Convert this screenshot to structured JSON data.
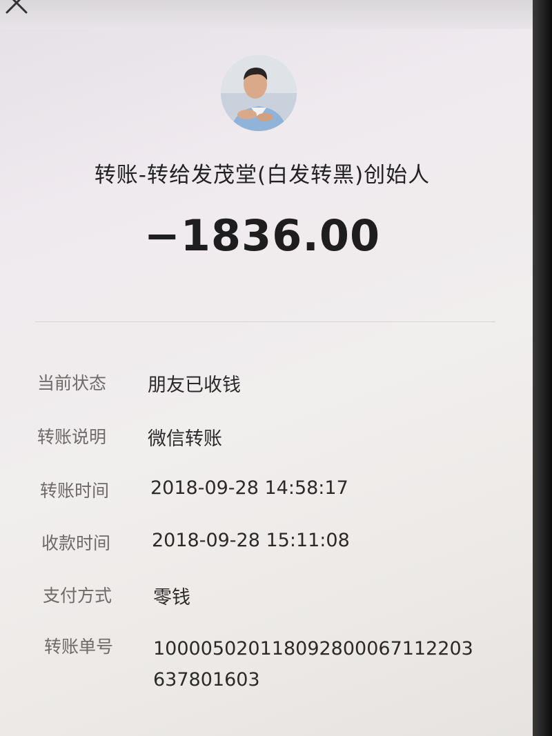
{
  "header": {
    "close_icon": "close-icon"
  },
  "payee": {
    "avatar_icon": "user-photo-avatar",
    "title": "转账-转给发茂堂(白发转黑)创始人",
    "amount": "−1836.00"
  },
  "details": [
    {
      "label": "当前状态",
      "value": "朋友已收钱"
    },
    {
      "label": "转账说明",
      "value": "微信转账"
    },
    {
      "label": "转账时间",
      "value": "2018-09-28 14:58:17"
    },
    {
      "label": "收款时间",
      "value": "2018-09-28 15:11:08"
    },
    {
      "label": "支付方式",
      "value": "零钱"
    },
    {
      "label": "转账单号",
      "value": "1000050201180928000671122036378016 03",
      "value_line1": "100005020118092800067112203",
      "value_line2": "637801603"
    }
  ]
}
